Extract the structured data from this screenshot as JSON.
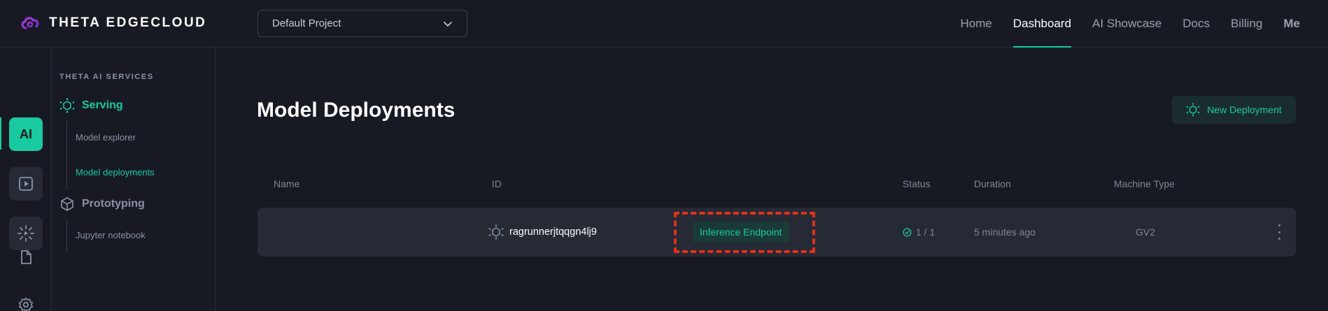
{
  "brand": {
    "name": "THETA EDGECLOUD"
  },
  "project": {
    "selected": "Default Project"
  },
  "nav": {
    "items": [
      {
        "label": "Home"
      },
      {
        "label": "Dashboard",
        "active": true
      },
      {
        "label": "AI Showcase"
      },
      {
        "label": "Docs"
      },
      {
        "label": "Billing"
      },
      {
        "label": "Me"
      }
    ]
  },
  "rail": {
    "ai_label": "AI"
  },
  "sidebar": {
    "heading": "THETA AI SERVICES",
    "serving": {
      "label": "Serving",
      "links": [
        "Model explorer",
        "Model deployments"
      ]
    },
    "prototyping": {
      "label": "Prototyping",
      "links": [
        "Jupyter notebook"
      ]
    }
  },
  "main": {
    "title": "Model Deployments",
    "new_button": "New Deployment",
    "columns": [
      "Name",
      "ID",
      "Status",
      "Duration",
      "Machine Type"
    ],
    "rows": [
      {
        "name": "",
        "id": "ragrunnerjtqqgn4lj9",
        "type": "Inference Endpoint",
        "status": "1 / 1",
        "duration": "5 minutes ago",
        "machine": "GV2"
      }
    ]
  },
  "colors": {
    "accent": "#19c9a0",
    "background": "#171a23",
    "highlight": "#e3311a"
  }
}
